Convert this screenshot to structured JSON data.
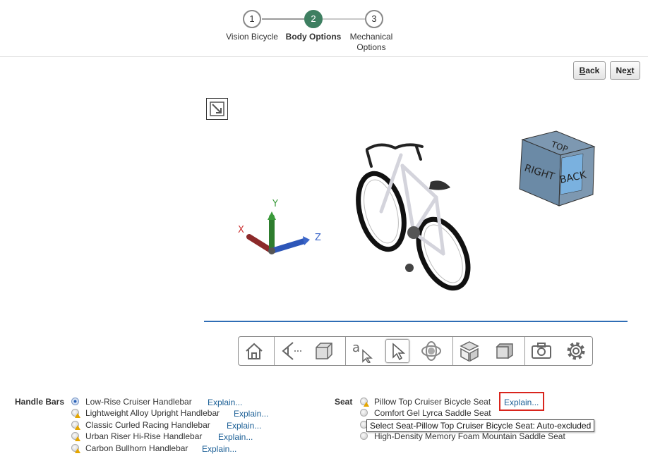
{
  "stepper": {
    "steps": [
      {
        "number": "1",
        "label": "Vision Bicycle",
        "state": "complete"
      },
      {
        "number": "2",
        "label": "Body Options",
        "state": "current"
      },
      {
        "number": "3",
        "label_line1": "Mechanical",
        "label_line2": "Options",
        "state": "upcoming"
      }
    ]
  },
  "nav": {
    "back_label": "ack",
    "back_access": "B",
    "next_label_pre": "Ne",
    "next_access": "x",
    "next_label_post": "t"
  },
  "viewer": {
    "axes": {
      "x": "X",
      "y": "Y",
      "z": "Z"
    },
    "view_cube": {
      "top": "TOP",
      "right": "RIGHT",
      "back": "BACK"
    },
    "toolbar_icons": [
      "home-icon",
      "eye-view-icon",
      "box-view-icon",
      "annotation-select-icon",
      "pointer-select-icon",
      "rotate-icon",
      "explode-icon",
      "section-icon",
      "camera-icon",
      "settings-icon"
    ]
  },
  "handle_bars": {
    "label": "Handle Bars",
    "options": [
      {
        "label": "Low-Rise Cruiser Handlebar",
        "explain": "Explain...",
        "selected": true,
        "warning": false
      },
      {
        "label": "Lightweight Alloy Upright Handlebar",
        "explain": "Explain...",
        "selected": false,
        "warning": true
      },
      {
        "label": "Classic Curled Racing Handlebar",
        "explain": "Explain...",
        "selected": false,
        "warning": true
      },
      {
        "label": "Urban Riser Hi-Rise Handlebar",
        "explain": "Explain...",
        "selected": false,
        "warning": true
      },
      {
        "label": "Carbon Bullhorn Handlebar",
        "explain": "Explain...",
        "selected": false,
        "warning": true
      }
    ]
  },
  "seat": {
    "label": "Seat",
    "options": [
      {
        "label": "Pillow Top Cruiser Bicycle Seat",
        "explain": "Explain...",
        "selected": false,
        "warning": true
      },
      {
        "label": "Comfort Gel Lyrca Saddle Seat",
        "selected": false,
        "warning": false
      },
      {
        "label": "",
        "selected": false,
        "warning": false
      },
      {
        "label": "High-Density Memory Foam Mountain Saddle Seat",
        "selected": false,
        "warning": false
      }
    ],
    "tooltip": "Select Seat-Pillow Top Cruiser Bicycle Seat: Auto-excluded"
  },
  "colors": {
    "accent": "#3e7f61",
    "link": "#1b5f96",
    "highlight": "#d9251d",
    "viewer_line": "#2f6db5"
  }
}
